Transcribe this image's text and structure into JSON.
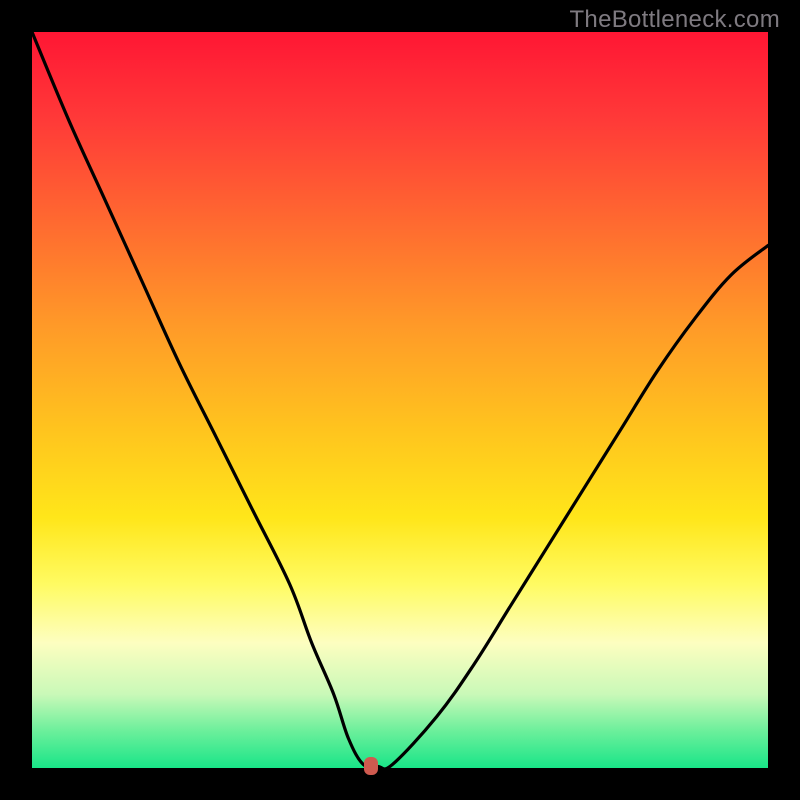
{
  "watermark": "TheBottleneck.com",
  "chart_data": {
    "type": "line",
    "title": "",
    "xlabel": "",
    "ylabel": "",
    "xlim": [
      0,
      100
    ],
    "ylim": [
      0,
      100
    ],
    "series": [
      {
        "name": "curve",
        "x": [
          0,
          5,
          10,
          15,
          20,
          25,
          30,
          35,
          38,
          41,
          43,
          45,
          47,
          49,
          55,
          60,
          65,
          70,
          75,
          80,
          85,
          90,
          95,
          100
        ],
        "y": [
          100,
          88,
          77,
          66,
          55,
          45,
          35,
          25,
          17,
          10,
          4,
          0.5,
          0.2,
          0.5,
          7,
          14,
          22,
          30,
          38,
          46,
          54,
          61,
          67,
          71
        ]
      }
    ],
    "marker": {
      "x": 46,
      "y": 0.3
    },
    "gradient_stops": [
      {
        "pos": 0,
        "color": "#ff1634"
      },
      {
        "pos": 12,
        "color": "#ff3a38"
      },
      {
        "pos": 26,
        "color": "#ff6a30"
      },
      {
        "pos": 40,
        "color": "#ff9a28"
      },
      {
        "pos": 54,
        "color": "#ffc41e"
      },
      {
        "pos": 66,
        "color": "#ffe61a"
      },
      {
        "pos": 75,
        "color": "#fffb62"
      },
      {
        "pos": 83,
        "color": "#fdfec0"
      },
      {
        "pos": 90,
        "color": "#c9f9b8"
      },
      {
        "pos": 95,
        "color": "#6bef9b"
      },
      {
        "pos": 100,
        "color": "#19e588"
      }
    ]
  }
}
